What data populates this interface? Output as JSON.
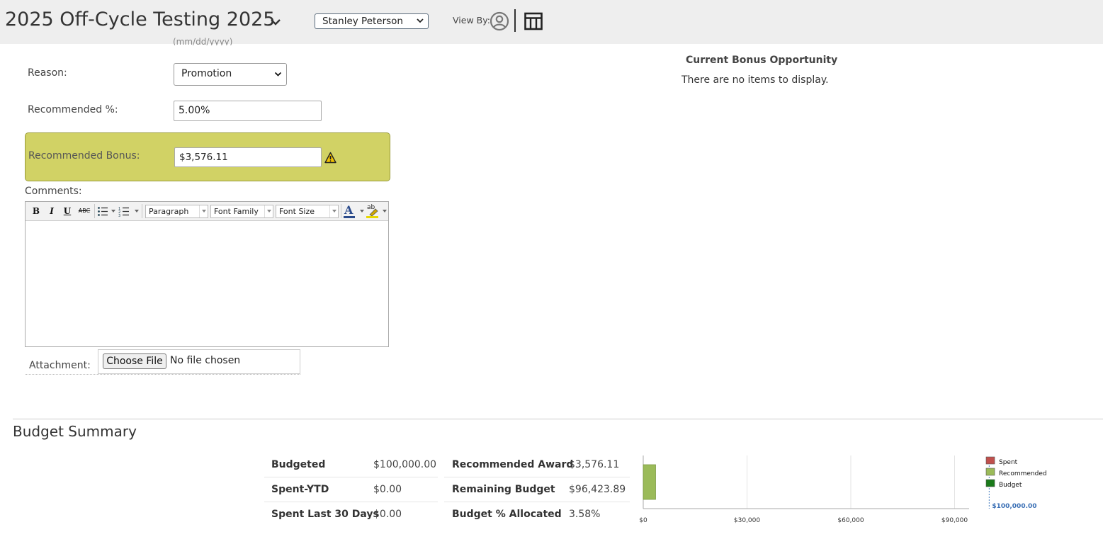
{
  "header": {
    "title": "2025 Off-Cycle Testing 2025",
    "employee_select": "Stanley Peterson",
    "view_by_label": "View By:"
  },
  "form": {
    "date_hint": "(mm/dd/yyyy)",
    "reason_label": "Reason:",
    "reason_value": "Promotion",
    "recommended_pct_label": "Recommended %:",
    "recommended_pct_value": "5.00%",
    "recommended_bonus_label": "Recommended Bonus:",
    "recommended_bonus_value": "$3,576.11",
    "highlight_color": "#d1d265",
    "comments_label": "Comments:",
    "editor_toolbar": {
      "bold": "B",
      "italic": "I",
      "underline": "U",
      "strike": "ABC",
      "paragraph": "Paragraph",
      "font_family": "Font Family",
      "font_size": "Font Size",
      "font_color_glyph": "A",
      "highlight_glyph": "ab"
    },
    "attachment_label": "Attachment:",
    "choose_file_label": "Choose File",
    "no_file_text": "No file chosen"
  },
  "bonus_opportunity": {
    "title": "Current Bonus Opportunity",
    "empty_text": "There are no items to display."
  },
  "budget_summary": {
    "title": "Budget Summary",
    "left_rows": [
      {
        "label": "Budgeted",
        "value": "$100,000.00"
      },
      {
        "label": "Spent-YTD",
        "value": "$0.00"
      },
      {
        "label": "Spent Last 30 Days",
        "value": "$0.00"
      }
    ],
    "right_rows": [
      {
        "label": "Recommended Award",
        "value": "$3,576.11"
      },
      {
        "label": "Remaining Budget",
        "value": "$96,423.89"
      },
      {
        "label": "Budget % Allocated",
        "value": "3.58%"
      }
    ]
  },
  "chart_data": {
    "type": "bar",
    "orientation": "horizontal",
    "x_ticks": [
      "$0",
      "$30,000",
      "$60,000",
      "$90,000"
    ],
    "xlim": [
      0,
      95000
    ],
    "series": [
      {
        "name": "Spent",
        "value": 0,
        "color": "#c0504d"
      },
      {
        "name": "Recommended",
        "value": 3576.11,
        "color": "#9bbb59"
      },
      {
        "name": "Budget",
        "value": 100000,
        "color": "#1a7a1a"
      }
    ],
    "budget_marker_label": "$100,000.00",
    "legend": "right",
    "grid": true
  }
}
